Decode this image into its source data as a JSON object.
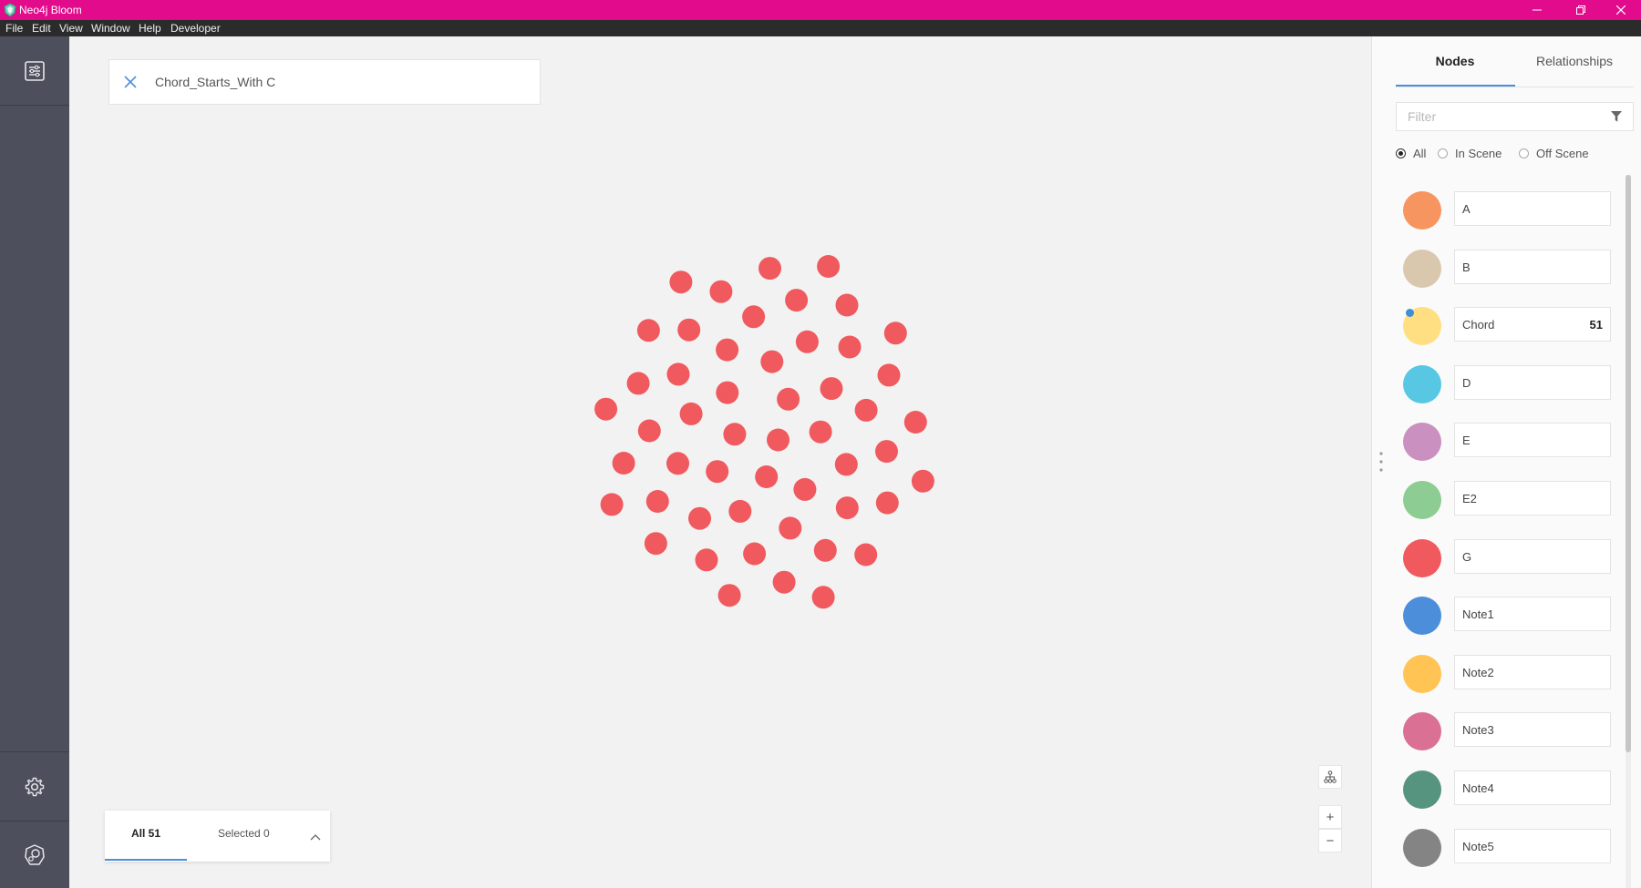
{
  "window": {
    "title": "Neo4j Bloom",
    "title_bar_color": "#e20b8c",
    "controls": [
      "minimize-icon",
      "restore-icon",
      "close-icon"
    ]
  },
  "menu": {
    "items": [
      "File",
      "Edit",
      "View",
      "Window",
      "Help",
      "Developer"
    ]
  },
  "sidebar": {
    "background": "#4d4f5c",
    "top_button_icon": "perspective-panel-icon",
    "bottom_buttons": [
      "gear-icon",
      "bloom-logo-icon"
    ]
  },
  "search": {
    "query": "Chord_Starts_With C",
    "clear_icon": "close-icon"
  },
  "graph": {
    "node_color": "#f0595e",
    "node_count": 51,
    "node_label": "Chord"
  },
  "results": {
    "all_label": "All 51",
    "selected_label": "Selected 0",
    "expand_icon": "chevron-up-icon"
  },
  "map_controls": {
    "layout_icon": "hierarchy-layout-icon",
    "zoom_in_label": "+",
    "zoom_out_label": "−"
  },
  "panel": {
    "tabs": [
      "Nodes",
      "Relationships"
    ],
    "active_tab": "Nodes",
    "filter_placeholder": "Filter",
    "filter_icon": "funnel-icon",
    "scope_options": [
      "All",
      "In Scene",
      "Off Scene"
    ],
    "scope_selected": "All",
    "categories": [
      {
        "label": "A",
        "color": "#f6955f",
        "count": ""
      },
      {
        "label": "B",
        "color": "#d9c8ae",
        "count": ""
      },
      {
        "label": "Chord",
        "color": "#ffdf81",
        "count": "51",
        "in_scene": true
      },
      {
        "label": "D",
        "color": "#57c7e3",
        "count": ""
      },
      {
        "label": "E",
        "color": "#c990c0",
        "count": ""
      },
      {
        "label": "E2",
        "color": "#8dcc93",
        "count": ""
      },
      {
        "label": "G",
        "color": "#f0595e",
        "count": ""
      },
      {
        "label": "Note1",
        "color": "#4c8eda",
        "count": ""
      },
      {
        "label": "Note2",
        "color": "#ffc454",
        "count": ""
      },
      {
        "label": "Note3",
        "color": "#da7194",
        "count": ""
      },
      {
        "label": "Note4",
        "color": "#569480",
        "count": ""
      },
      {
        "label": "Note5",
        "color": "#848484",
        "count": ""
      }
    ]
  }
}
